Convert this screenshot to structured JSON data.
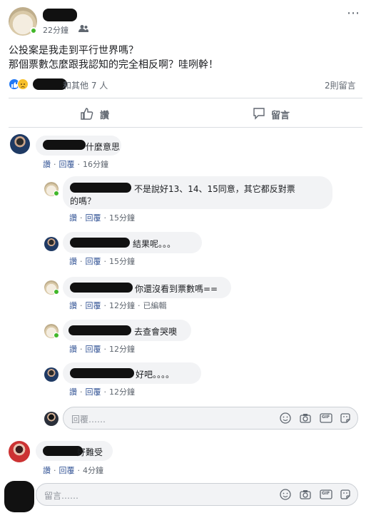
{
  "post": {
    "time": "22分鐘",
    "line1": "公投案是我走到平行世界嗎？",
    "line2": "那個票數怎麼跟我認知的完全相反啊？哇咧幹！",
    "reactions_text": "和其他 7 人",
    "comments_count": "2則留言",
    "like_label": "讚",
    "comment_label": "留言",
    "more_glyph": "⋯"
  },
  "comments": [
    {
      "text": "什麼意思",
      "like": "讚",
      "reply": "回覆",
      "time": "16分鐘"
    }
  ],
  "replies": [
    {
      "text1": "不是說好13、14、15同意，其它都反對票",
      "text2": "的嗎？",
      "like": "讚",
      "reply": "回覆",
      "time": "15分鐘"
    },
    {
      "text": "結果呢。。。",
      "like": "讚",
      "reply": "回覆",
      "time": "15分鐘"
    },
    {
      "text": "你還沒看到票數嗎==",
      "like": "讚",
      "reply": "回覆",
      "time": "12分鐘",
      "edited": "已編輯"
    },
    {
      "text": "去查會哭噢",
      "like": "讚",
      "reply": "回覆",
      "time": "12分鐘"
    },
    {
      "text": "好吧。。。。",
      "like": "讚",
      "reply": "回覆",
      "time": "12分鐘"
    }
  ],
  "reply_input": {
    "placeholder": "回覆……"
  },
  "comment2": {
    "text": "好難受",
    "like": "讚",
    "reply": "回覆",
    "time": "4分鐘"
  },
  "comment_input": {
    "placeholder": "留言……"
  },
  "input_icons": {
    "gif": "GIF"
  },
  "colors": {
    "link": "#385898",
    "online": "#42b72a",
    "bubble": "#f2f3f5"
  }
}
